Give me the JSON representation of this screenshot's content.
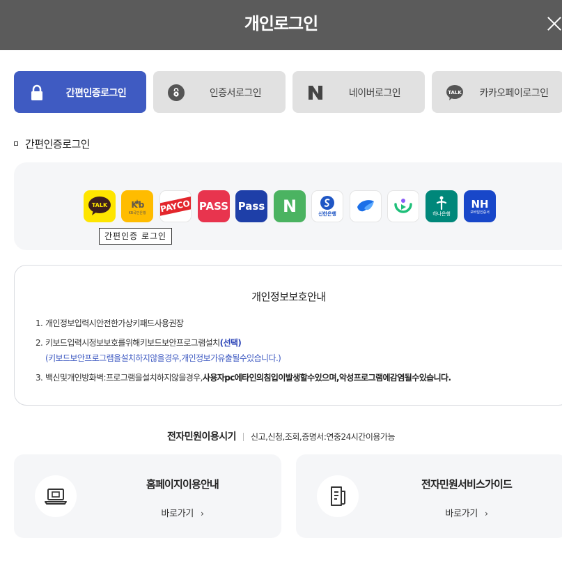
{
  "header": {
    "title": "개인로그인"
  },
  "tabs": [
    {
      "label": "간편인증로그인",
      "icon": "lock-icon",
      "active": true
    },
    {
      "label": "인증서로그인",
      "icon": "certificate-icon",
      "active": false
    },
    {
      "label": "네이버로그인",
      "icon": "naver-icon",
      "active": false
    },
    {
      "label": "카카오페이로그인",
      "icon": "kakao-talk-icon",
      "active": false
    }
  ],
  "section": {
    "title": "간편인증로그인"
  },
  "certs": {
    "kakao": "TALK",
    "kb": "KB국민은행",
    "payco": "PAYCO",
    "pass_red": "PASS",
    "pass_blue": "Pass",
    "naver": "N",
    "shinhan": "신한은행",
    "toss": "toss-icon",
    "banksalad": "banksalad-icon",
    "hana": "하나은행",
    "nh_top": "NH",
    "nh_bottom": "모바일인증서"
  },
  "tooltip": "간편인증 로그인",
  "privacy": {
    "title": "개인정보보호안내",
    "items": [
      {
        "num": "1.",
        "text": "개인정보입력시안전한가상키패드사용권장"
      },
      {
        "num": "2.",
        "text": "키보드입력시정보보호를위해키보드보안프로그램설치",
        "highlight": "(선택)",
        "sub": "(키보드보안프로그램을설치하지않을경우,개인정보가유출될수있습니다.)"
      },
      {
        "num": "3.",
        "text": "백신및개인방화벽:프로그램을설치하지않을경우,",
        "strong": "사용자pc에타인의침입이발생할수있으며,악성프로그램에감염될수있습니다."
      }
    ]
  },
  "usage": {
    "label": "전자민원이용시기",
    "value": "신고,신청,조회,증명서:연중24시간이용가능"
  },
  "cards": [
    {
      "title": "홈페이지이용안내",
      "link": "바로가기",
      "icon": "laptop-icon"
    },
    {
      "title": "전자민원서비스가이드",
      "link": "바로가기",
      "icon": "document-icon"
    }
  ],
  "colors": {
    "header": "#5b5b5b",
    "accent": "#3f5bc2",
    "tab_inactive": "#e1e1e1",
    "panel": "#f5f6f8"
  }
}
